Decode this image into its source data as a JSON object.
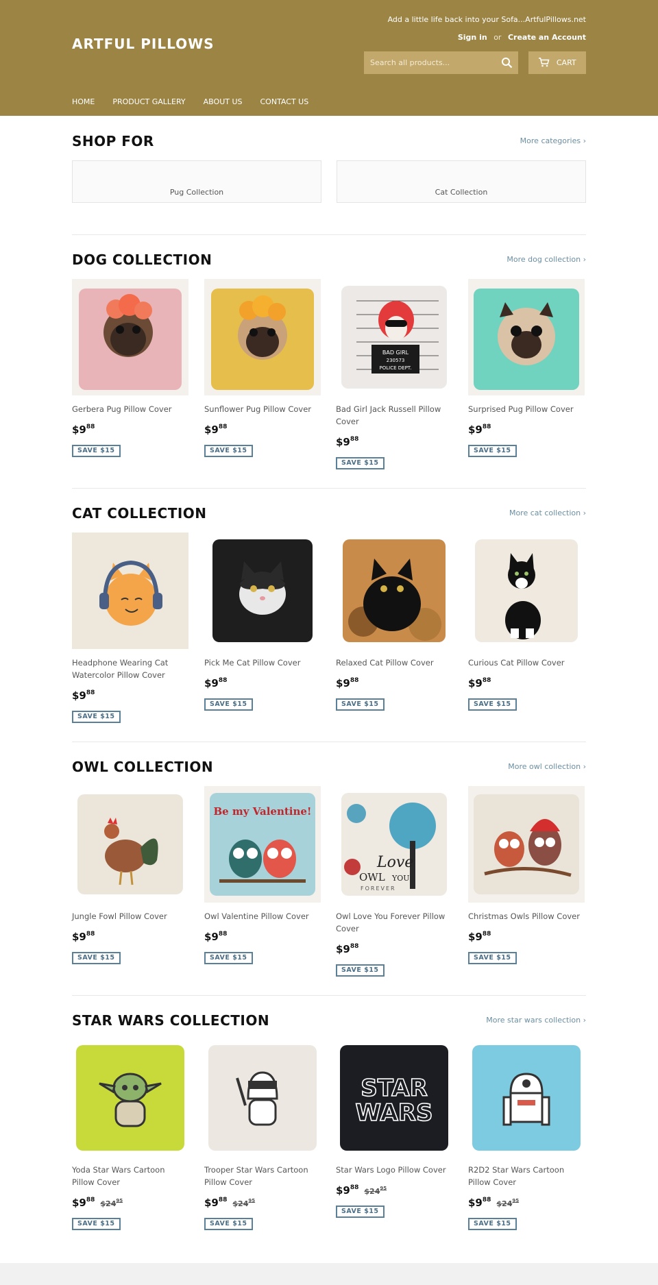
{
  "header": {
    "tagline": "Add a little life back into your Sofa...ArtfulPillows.net",
    "sign_in": "Sign in",
    "or": "or",
    "create_account": "Create an Account",
    "logo": "ARTFUL PILLOWS",
    "search_placeholder": "Search all products...",
    "cart_label": "CART",
    "nav": [
      "HOME",
      "PRODUCT GALLERY",
      "ABOUT US",
      "CONTACT US"
    ]
  },
  "shop_for": {
    "title": "SHOP FOR",
    "more": "More categories ›",
    "categories": [
      "Pug Collection",
      "Cat Collection"
    ]
  },
  "sections": [
    {
      "title": "DOG COLLECTION",
      "more": "More dog collection ›",
      "products": [
        {
          "title": "Gerbera Pug Pillow Cover",
          "price_main": "$9",
          "price_cents": "88",
          "save": "SAVE $15",
          "image": "pug-flower-pink"
        },
        {
          "title": "Sunflower Pug Pillow Cover",
          "price_main": "$9",
          "price_cents": "88",
          "save": "SAVE $15",
          "image": "pug-flower-yellow"
        },
        {
          "title": "Bad Girl Jack Russell Pillow Cover",
          "price_main": "$9",
          "price_cents": "88",
          "save": "SAVE $15",
          "image": "mugshot-dog"
        },
        {
          "title": "Surprised Pug Pillow Cover",
          "price_main": "$9",
          "price_cents": "88",
          "save": "SAVE $15",
          "image": "pug-teal"
        }
      ]
    },
    {
      "title": "CAT COLLECTION",
      "more": "More cat collection ›",
      "products": [
        {
          "title": "Headphone Wearing Cat Watercolor Pillow Cover",
          "price_main": "$9",
          "price_cents": "88",
          "save": "SAVE $15",
          "image": "cat-headphones"
        },
        {
          "title": "Pick Me Cat Pillow Cover",
          "price_main": "$9",
          "price_cents": "88",
          "save": "SAVE $15",
          "image": "cat-black-white"
        },
        {
          "title": "Relaxed Cat Pillow Cover",
          "price_main": "$9",
          "price_cents": "88",
          "save": "SAVE $15",
          "image": "cat-black-leaves"
        },
        {
          "title": "Curious Cat Pillow Cover",
          "price_main": "$9",
          "price_cents": "88",
          "save": "SAVE $15",
          "image": "cat-tuxedo"
        }
      ]
    },
    {
      "title": "OWL COLLECTION",
      "more": "More owl collection ›",
      "products": [
        {
          "title": "Jungle Fowl Pillow Cover",
          "price_main": "$9",
          "price_cents": "88",
          "save": "SAVE $15",
          "image": "rooster"
        },
        {
          "title": "Owl Valentine Pillow Cover",
          "price_main": "$9",
          "price_cents": "88",
          "save": "SAVE $15",
          "image": "owl-valentine"
        },
        {
          "title": "Owl Love You Forever Pillow Cover",
          "price_main": "$9",
          "price_cents": "88",
          "save": "SAVE $15",
          "image": "owl-tree"
        },
        {
          "title": "Christmas Owls Pillow Cover",
          "price_main": "$9",
          "price_cents": "88",
          "save": "SAVE $15",
          "image": "owl-christmas"
        }
      ]
    },
    {
      "title": "STAR WARS COLLECTION",
      "more": "More star wars collection ›",
      "products": [
        {
          "title": "Yoda Star Wars Cartoon Pillow Cover",
          "price_main": "$9",
          "price_cents": "88",
          "orig_main": "$24",
          "orig_cents": "95",
          "save": "SAVE $15",
          "image": "yoda"
        },
        {
          "title": "Trooper Star Wars Cartoon Pillow Cover",
          "price_main": "$9",
          "price_cents": "88",
          "orig_main": "$24",
          "orig_cents": "95",
          "save": "SAVE $15",
          "image": "trooper"
        },
        {
          "title": "Star Wars Logo Pillow Cover",
          "price_main": "$9",
          "price_cents": "88",
          "orig_main": "$24",
          "orig_cents": "95",
          "save": "SAVE $15",
          "image": "star-wars-logo"
        },
        {
          "title": "R2D2 Star Wars Cartoon Pillow Cover",
          "price_main": "$9",
          "price_cents": "88",
          "orig_main": "$24",
          "orig_cents": "95",
          "save": "SAVE $15",
          "image": "r2d2"
        }
      ]
    }
  ],
  "image_text": {
    "mugshot": [
      "BAD GIRL",
      "230573",
      "POLICE DEPT."
    ],
    "valentine": "Be my Valentine!",
    "owl_love": [
      "Love",
      "OWL",
      "YOU",
      "FOREVER"
    ],
    "star_wars": [
      "STAR",
      "WARS"
    ]
  },
  "colors": {
    "header_bg": "#9b8444",
    "search_bg": "#c2a86a",
    "link": "#6b8ea1",
    "badge": "#5a7f99"
  }
}
